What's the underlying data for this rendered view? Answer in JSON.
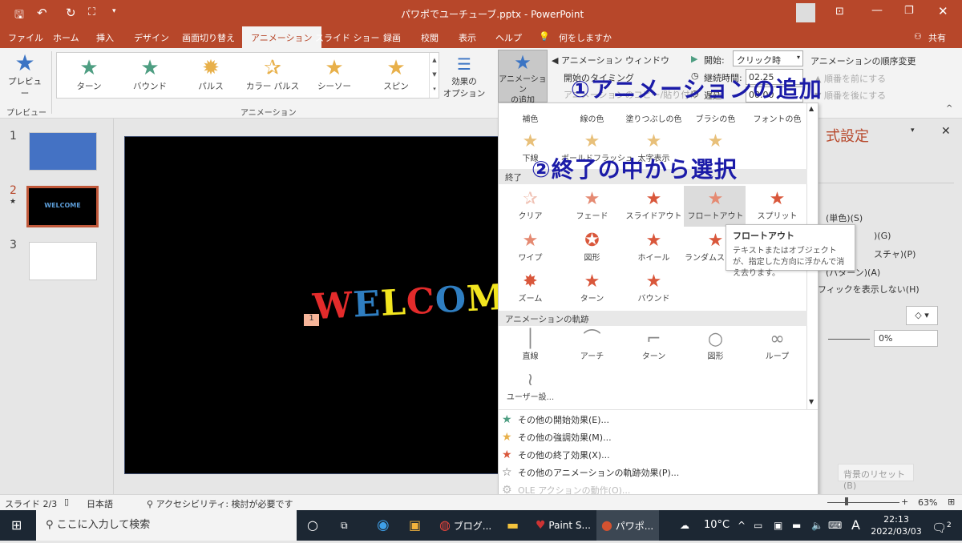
{
  "window": {
    "title": "パワポでユーチューブ.pptx - PowerPoint",
    "accent": "#b7472a"
  },
  "qat": {
    "save": "save-icon",
    "undo": "undo-icon",
    "redo": "redo-icon",
    "present": "present-icon",
    "more": "▾"
  },
  "tabs": [
    "ファイル",
    "ホーム",
    "挿入",
    "デザイン",
    "画面切り替え",
    "アニメーション",
    "スライド ショー",
    "録画",
    "校閲",
    "表示",
    "ヘルプ"
  ],
  "tell_me": "何をしますか",
  "share": "共有",
  "ribbon": {
    "preview_label": "プレビュー",
    "preview_group": "プレビュー",
    "gallery": [
      {
        "label": "ターン",
        "color": "#4e9e82"
      },
      {
        "label": "バウンド",
        "color": "#4e9e82"
      },
      {
        "label": "パルス",
        "color": "#e8b04a"
      },
      {
        "label": "カラー パルス",
        "color": "#e8b04a"
      },
      {
        "label": "シーソー",
        "color": "#e8b04a"
      },
      {
        "label": "スピン",
        "color": "#e8b04a"
      }
    ],
    "animation_group": "アニメーション",
    "effect_options": "効果の\nオプション",
    "add_animation": "アニメーション\nの追加",
    "animation_pane": "アニメーション ウィンドウ",
    "trigger": "開始のタイミング",
    "painter": "アニメーションのコピー/貼り付け",
    "start_label": "開始:",
    "start_value": "クリック時",
    "duration_label": "継続時間:",
    "duration_value": "02.25",
    "delay_label": "遅延:",
    "delay_value": "00.00",
    "reorder_title": "アニメーションの順序変更",
    "move_earlier": "順番を前にする",
    "move_later": "順番を後にする"
  },
  "slides": [
    {
      "num": "1",
      "bg": "#4472c4"
    },
    {
      "num": "2",
      "bg": "#000000",
      "text": "WELCOME",
      "selected": true
    },
    {
      "num": "3",
      "bg": "#ffffff"
    }
  ],
  "slide": {
    "welcome_letters": [
      {
        "ch": "W",
        "color": "#e32b2b"
      },
      {
        "ch": "E",
        "color": "#2f7ec1"
      },
      {
        "ch": "L",
        "color": "#f2e51f"
      },
      {
        "ch": "C",
        "color": "#e32b2b"
      },
      {
        "ch": "O",
        "color": "#2f7ec1"
      },
      {
        "ch": "M",
        "color": "#f2e51f"
      }
    ],
    "anim_tag": "1"
  },
  "dropdown": {
    "emph_labels": [
      "補色",
      "線の色",
      "塗りつぶしの色",
      "ブラシの色",
      "フォントの色"
    ],
    "emph_row2": [
      "U",
      "B",
      "B",
      "A"
    ],
    "emph_row2_labels": [
      "下線",
      "ボールドフラッシュ",
      "太字表示",
      "",
      ""
    ],
    "exit_header": "終了",
    "exit": [
      [
        "クリア",
        "フェード",
        "スライドアウト",
        "フロートアウト",
        "スプリット"
      ],
      [
        "ワイプ",
        "図形",
        "ホイール",
        "ランダムストライプ"
      ],
      [
        "ズーム",
        "ターン",
        "バウンド"
      ]
    ],
    "exit_hovered": "フロートアウト",
    "path_header": "アニメーションの軌跡",
    "paths": [
      "直線",
      "アーチ",
      "ターン",
      "図形",
      "ループ",
      "ユーザー設..."
    ],
    "menu": [
      {
        "label": "その他の開始効果(E)...",
        "color": "#4e9e82"
      },
      {
        "label": "その他の強調効果(M)...",
        "color": "#e8b04a"
      },
      {
        "label": "その他の終了効果(X)...",
        "color": "#d9573b"
      },
      {
        "label": "その他のアニメーションの軌跡効果(P)...",
        "color": "#666666"
      },
      {
        "label": "OLE アクションの動作(O)...",
        "color": "#bbbbbb",
        "disabled": true
      }
    ]
  },
  "tooltip": {
    "title": "フロートアウト",
    "body": "テキストまたはオブジェクトが、指定した方向に浮かんで消え去ります。"
  },
  "annotations": {
    "a1": "①アニメーションの追加",
    "a2": "②終了の中から選択"
  },
  "pane": {
    "title": "式設定",
    "items": [
      "(単色)(S)",
      ")(G)",
      "スチャ)(P)",
      "(パターン)(A)",
      "フィックを表示しない(H)"
    ],
    "transparency": "0%",
    "reset": "背景のリセット(B)"
  },
  "status": {
    "slide": "スライド 2/3",
    "lang": "日本語",
    "accessibility": "アクセシビリティ: 検討が必要です",
    "zoom": "63%"
  },
  "taskbar": {
    "search": "ここに入力して検索",
    "apps": [
      "ブログ...",
      "Paint S...",
      "パワポ..."
    ],
    "weather": "10°C",
    "ime": "A",
    "time": "22:13",
    "date": "2022/03/03",
    "notif": "2"
  }
}
